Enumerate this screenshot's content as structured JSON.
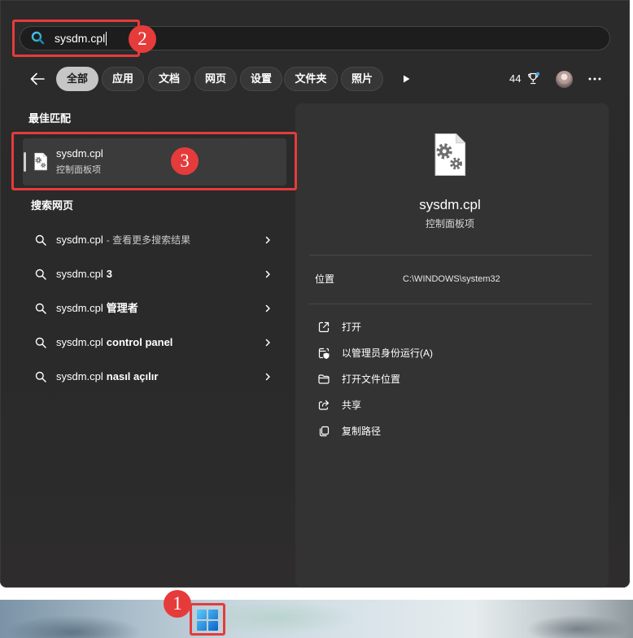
{
  "search": {
    "query": "sysdm.cpl",
    "icon": "search-icon"
  },
  "filters": {
    "back_icon": "back-arrow-icon",
    "chips": [
      {
        "label": "全部",
        "selected": true
      },
      {
        "label": "应用",
        "selected": false
      },
      {
        "label": "文档",
        "selected": false
      },
      {
        "label": "网页",
        "selected": false
      },
      {
        "label": "设置",
        "selected": false
      },
      {
        "label": "文件夹",
        "selected": false
      },
      {
        "label": "照片",
        "selected": false
      }
    ],
    "more_filters_icon": "play-icon"
  },
  "account": {
    "points": "44",
    "points_icon": "trophy-icon",
    "avatar_icon": "avatar-icon",
    "menu_icon": "more-icon"
  },
  "best_match": {
    "heading": "最佳匹配",
    "item": {
      "title": "sysdm.cpl",
      "subtitle": "控制面板项",
      "icon": "settings-file-icon"
    }
  },
  "web_search": {
    "heading": "搜索网页",
    "items": [
      {
        "query": "sysdm.cpl",
        "suffix": "- 查看更多搜索结果",
        "suffix_bold": false
      },
      {
        "query": "sysdm.cpl",
        "suffix": "3",
        "suffix_bold": true
      },
      {
        "query": "sysdm.cpl",
        "suffix": "管理者",
        "suffix_bold": true
      },
      {
        "query": "sysdm.cpl",
        "suffix": "control panel",
        "suffix_bold": true
      },
      {
        "query": "sysdm.cpl",
        "suffix": "nasıl açılır",
        "suffix_bold": true
      }
    ]
  },
  "details": {
    "icon": "settings-file-icon",
    "title": "sysdm.cpl",
    "subtitle": "控制面板项",
    "location_label": "位置",
    "location_value": "C:\\WINDOWS\\system32",
    "actions": [
      {
        "label": "打开",
        "icon": "open-icon"
      },
      {
        "label": "以管理员身份运行(A)",
        "icon": "run-as-admin-icon"
      },
      {
        "label": "打开文件位置",
        "icon": "folder-icon"
      },
      {
        "label": "共享",
        "icon": "share-icon"
      },
      {
        "label": "复制路径",
        "icon": "copy-path-icon"
      }
    ]
  },
  "taskbar": {
    "start_icon": "windows-start-icon"
  },
  "annotations": {
    "start_marker": "1",
    "search_marker": "2",
    "best_match_marker": "3"
  },
  "colors": {
    "panel_bg": "#2b2b2b",
    "card_bg": "#333333",
    "search_bg": "#1d1d1d",
    "chip_bg": "#373737",
    "chip_selected_bg": "#c6c6c6",
    "row_selected_bg": "#3b3b3b",
    "annotation_red": "#e63b3b",
    "divider": "#474747",
    "start_blue": "#1a8ce8"
  }
}
